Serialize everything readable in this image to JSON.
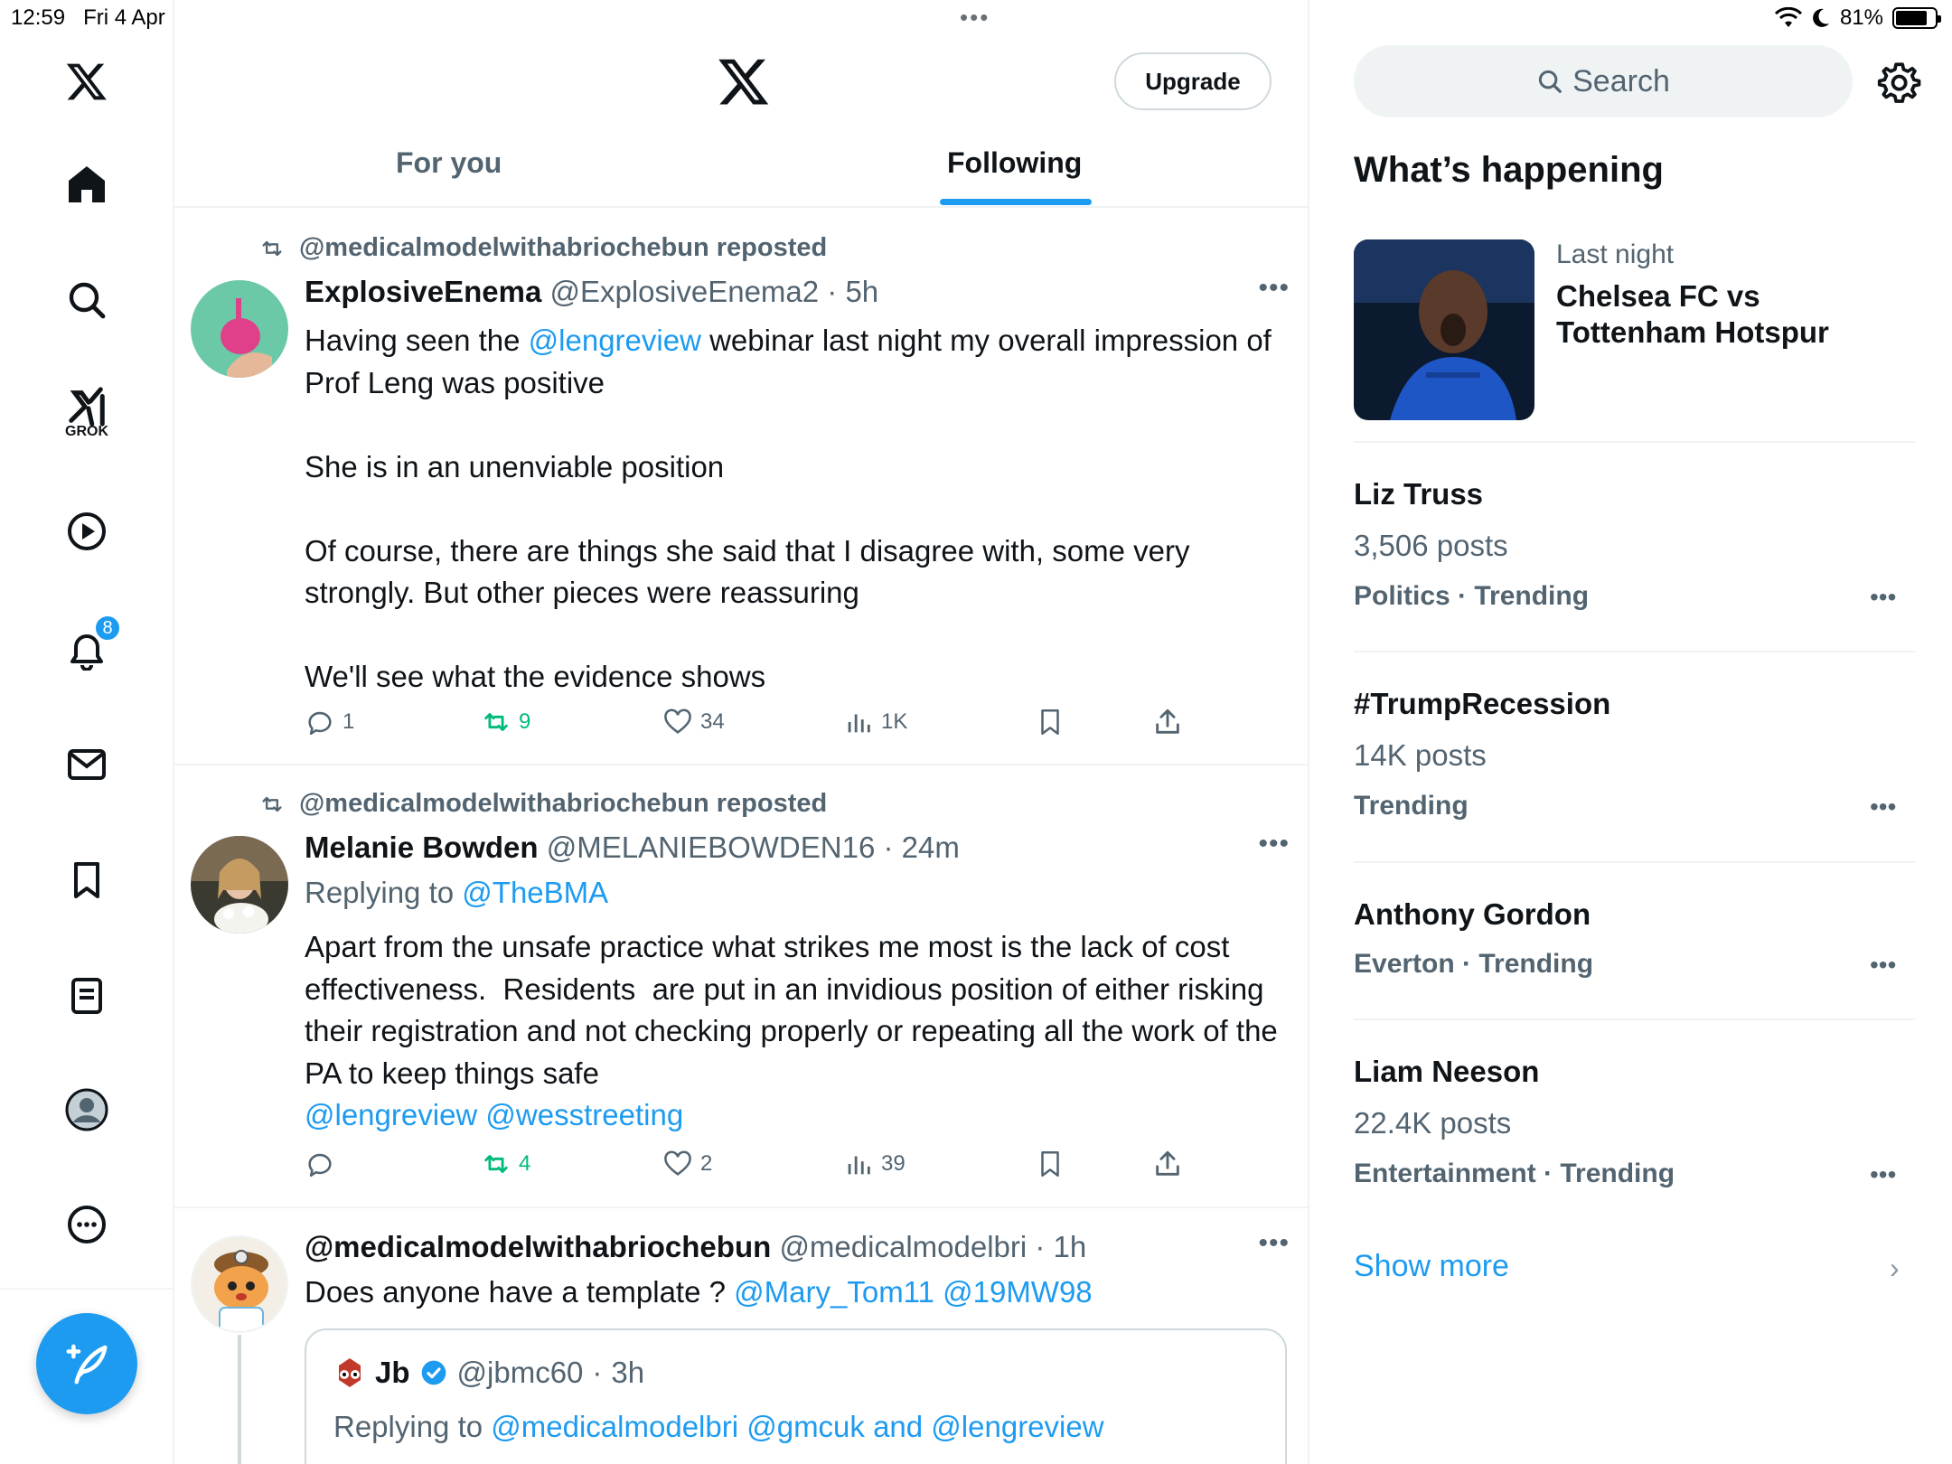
{
  "status_bar": {
    "time": "12:59",
    "date": "Fri 4 Apr",
    "battery": "81%",
    "battery_level": 0.81
  },
  "nav": {
    "grok_label": "GROK",
    "notifications_badge": "8"
  },
  "header": {
    "upgrade_label": "Upgrade",
    "tabs": [
      {
        "label": "For you",
        "selected": false
      },
      {
        "label": "Following",
        "selected": true
      }
    ]
  },
  "tweets": [
    {
      "repost_text": "@medicalmodelwithabriochebun reposted",
      "name": "ExplosiveEnema",
      "handle": "@ExplosiveEnema2",
      "time": "5h",
      "body_pre": "Having seen the ",
      "body_link": "@lengreview",
      "body_post": " webinar last night my overall impression of Prof Leng was positive\n\nShe is in an unenviable position\n\nOf course, there are things she said that I disagree with, some very strongly. But other pieces were reassuring\n\nWe'll see what the evidence shows",
      "replies": "1",
      "reposts": "9",
      "likes": "34",
      "views": "1K"
    },
    {
      "repost_text": "@medicalmodelwithabriochebun reposted",
      "name": "Melanie Bowden",
      "handle": "@MELANIEBOWDEN16",
      "time": "24m",
      "replying_label": "Replying to",
      "replying_handle": "@TheBMA",
      "body": "Apart from the unsafe practice what strikes me most is the lack of cost effectiveness.  Residents  are put in an invidious position of either risking their registration and not checking properly or repeating all the work of the PA to keep things safe",
      "mentions": "@lengreview @wesstreeting",
      "replies": "",
      "reposts": "4",
      "likes": "2",
      "views": "39"
    },
    {
      "name": "@medicalmodelwithabriochebun",
      "handle": "@medicalmodelbri",
      "time": "1h",
      "body": "Does anyone have a template ? ",
      "mentions": "@Mary_Tom11 @19MW98",
      "quote": {
        "name": "Jb",
        "handle": "@jbmc60",
        "time": "3h",
        "replying_label": "Replying to",
        "replying_handles": "@medicalmodelbri @gmcuk and @lengreview"
      }
    }
  ],
  "sidebar": {
    "search_placeholder": "Search",
    "title": "What’s happening",
    "news": {
      "meta": "Last night",
      "title": "Chelsea FC vs Tottenham Hotspur"
    },
    "trends": [
      {
        "name": "Liz Truss",
        "count": "3,506 posts",
        "category": "Politics · Trending"
      },
      {
        "name": "#TrumpRecession",
        "count": "14K posts",
        "category": "Trending"
      },
      {
        "name": "Anthony Gordon",
        "count": "",
        "category": "Everton · Trending"
      },
      {
        "name": "Liam Neeson",
        "count": "22.4K posts",
        "category": "Entertainment · Trending"
      }
    ],
    "show_more": "Show more"
  }
}
